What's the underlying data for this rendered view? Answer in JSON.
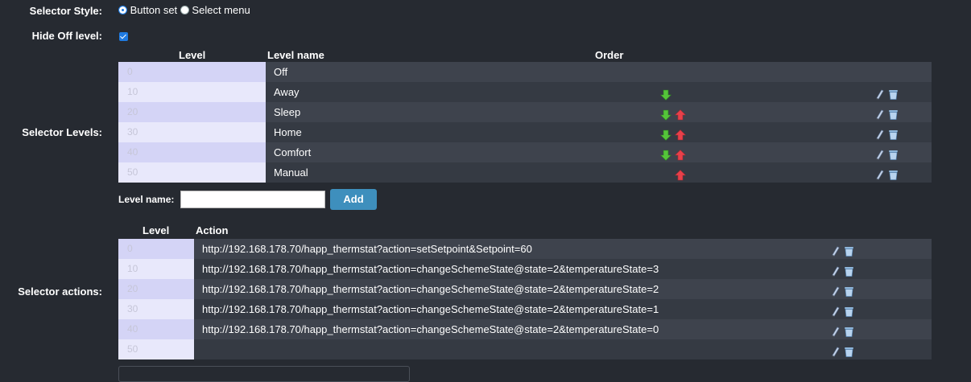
{
  "selector_style": {
    "label": "Selector Style:",
    "options": [
      {
        "label": "Button set",
        "selected": true
      },
      {
        "label": "Select menu",
        "selected": false
      }
    ]
  },
  "hide_off": {
    "label": "Hide Off level:",
    "checked": true
  },
  "levels": {
    "label": "Selector Levels:",
    "headers": {
      "level": "Level",
      "name": "Level name",
      "order": "Order"
    },
    "rows": [
      {
        "level": "0",
        "name": "Off",
        "down": false,
        "up": false,
        "tools": false
      },
      {
        "level": "10",
        "name": "Away",
        "down": true,
        "up": false,
        "tools": true
      },
      {
        "level": "20",
        "name": "Sleep",
        "down": true,
        "up": true,
        "tools": true
      },
      {
        "level": "30",
        "name": "Home",
        "down": true,
        "up": true,
        "tools": true
      },
      {
        "level": "40",
        "name": "Comfort",
        "down": true,
        "up": true,
        "tools": true
      },
      {
        "level": "50",
        "name": "Manual",
        "down": false,
        "up": true,
        "tools": true
      }
    ],
    "add": {
      "label": "Level name:",
      "input_value": "",
      "button": "Add"
    }
  },
  "actions": {
    "label": "Selector actions:",
    "headers": {
      "level": "Level",
      "action": "Action"
    },
    "rows": [
      {
        "level": "0",
        "action": "http://192.168.178.70/happ_thermstat?action=setSetpoint&Setpoint=60"
      },
      {
        "level": "10",
        "action": "http://192.168.178.70/happ_thermstat?action=changeSchemeState@state=2&temperatureState=3"
      },
      {
        "level": "20",
        "action": "http://192.168.178.70/happ_thermstat?action=changeSchemeState@state=2&temperatureState=2"
      },
      {
        "level": "30",
        "action": "http://192.168.178.70/happ_thermstat?action=changeSchemeState@state=2&temperatureState=1"
      },
      {
        "level": "40",
        "action": "http://192.168.178.70/happ_thermstat?action=changeSchemeState@state=2&temperatureState=0"
      },
      {
        "level": "50",
        "action": ""
      }
    ]
  },
  "icons": {
    "down": "arrow-down-green-icon",
    "up": "arrow-up-red-icon",
    "edit": "pencil-icon",
    "delete": "trash-icon"
  },
  "colors": {
    "background": "#262a31",
    "row_dark": "#353a43",
    "row_light": "#3e434d",
    "level_cell": "#e8e8fb",
    "accent": "#3e8fbd",
    "arrow_down": "#55c43a",
    "arrow_up": "#e8404a"
  }
}
